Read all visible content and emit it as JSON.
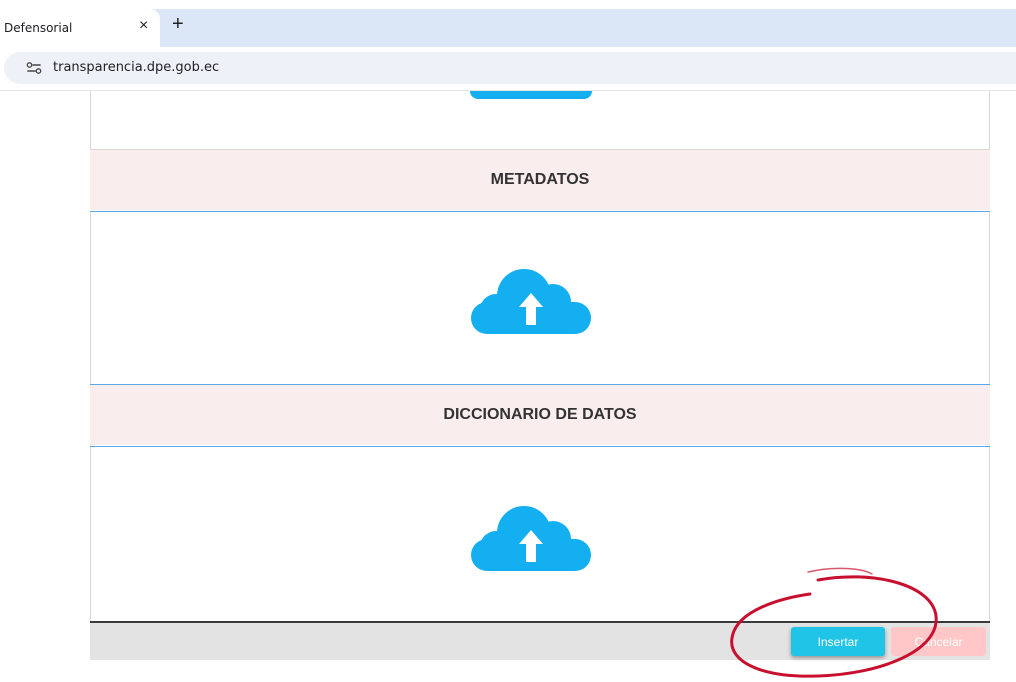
{
  "browser": {
    "tab_title": "Defensorial",
    "tab_close": "×",
    "new_tab": "+",
    "url": "transparencia.dpe.gob.ec"
  },
  "sections": [
    {
      "title": "METADATOS",
      "upload_icon": "cloud-upload-icon"
    },
    {
      "title": "DICCIONARIO DE DATOS",
      "upload_icon": "cloud-upload-icon"
    }
  ],
  "actions": {
    "insert_label": "Insertar",
    "cancel_label": "Cancelar"
  },
  "colors": {
    "cloud": "#14aff0",
    "section_header_bg": "#f9eded",
    "insert_button": "#1fc4e6",
    "cancel_button": "#ffc7c7",
    "annotation": "#c8102e"
  }
}
